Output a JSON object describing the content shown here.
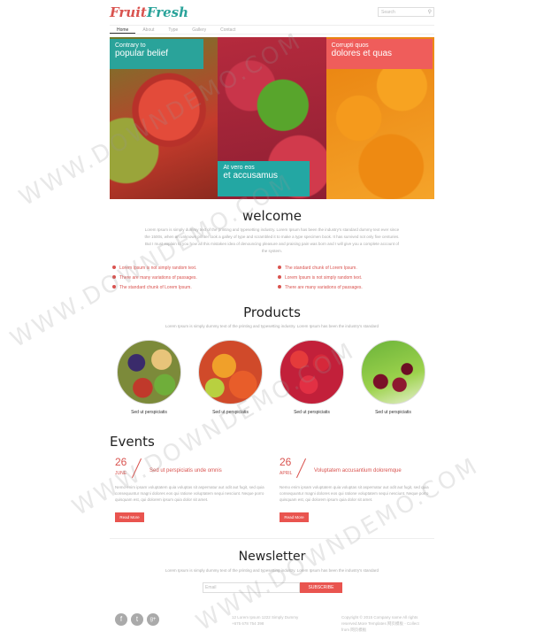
{
  "header": {
    "logo_part1": "Fruit",
    "logo_part2": "Fresh",
    "search_placeholder": "Search"
  },
  "nav": {
    "items": [
      "Home",
      "About",
      "Type",
      "Gallery",
      "Contact"
    ]
  },
  "hero": {
    "panel1": {
      "small": "Contrary to",
      "large": "popular belief"
    },
    "panel2": {
      "small": "At vero eos",
      "large": "et accusamus"
    },
    "panel3": {
      "small": "Corrupti quos",
      "large": "dolores et quas"
    }
  },
  "welcome": {
    "title": "welcome",
    "text": "Lorem Ipsum is simply dummy text of the printing and typesetting industry. Lorem Ipsum has been the industry's standard dummy text ever since the 1500s, when an unknown printer took a galley of type and scrambled it to make a type specimen book. It has survived not only five centuries. But I must explain to you how all this mistaken idea of denouncing pleasure and praising pain was born and I will give you a complete account of the system.",
    "bullets_left": [
      "Lorem Ipsum is not simply random text.",
      "There are many variations of passages.",
      "The standard chunk of Lorem Ipsum."
    ],
    "bullets_right": [
      "The standard chunk of Lorem Ipsum.",
      "Lorem Ipsum is not simply random text.",
      "There are many variations of passages."
    ]
  },
  "products": {
    "title": "Products",
    "text": "Lorem Ipsum is simply dummy text of the printing and typesetting industry. Lorem Ipsum has been the industry's standard",
    "items": [
      "Sed ut perspiciatis",
      "Sed ut perspiciatis",
      "Sed ut perspiciatis",
      "Sed ut perspiciatis"
    ]
  },
  "events": {
    "title": "Events",
    "items": [
      {
        "day": "26",
        "month": "JUNE",
        "title": "Sed ut perspiciatis unde omnis",
        "text": "Nemo enim ipsam voluptatem quia voluptas sit aspernatur aut odit aut fugit, sed quia consequuntur magni dolores eos qui ratione voluptatem sequi nesciunt. Neque porro quisquam est, qui dolorem ipsum quia dolor sit amet.",
        "button": "Read More"
      },
      {
        "day": "26",
        "month": "APRIL",
        "title": "Voluptatem accusantium doloremque",
        "text": "Nemo enim ipsam voluptatem quia voluptas sit aspernatur aut odit aut fugit, sed quia consequuntur magni dolores eos qui ratione voluptatem sequi nesciunt. Neque porro quisquam est, qui dolorem ipsum quia dolor sit amet.",
        "button": "Read More"
      }
    ]
  },
  "newsletter": {
    "title": "Newsletter",
    "text": "Lorem Ipsum is simply dummy text of the printing and typesetting industry. Lorem Ipsum has been the industry's standard",
    "placeholder": "Email",
    "button": "SUBSCRIBE"
  },
  "footer": {
    "social": [
      "f",
      "t",
      "g+"
    ],
    "address_line1": "12 Lorem Ipsum 1222 Simply Dummy",
    "address_line2": "+675 678 754 398",
    "copyright_line1": "Copyright © 2015 Company name All rights",
    "copyright_line2": "reserved.More Templates 网页模板 - Collect from 网页模板"
  },
  "watermark": "WWW.DOWNDEMO.COM",
  "colors": {
    "accent_red": "#e9544f",
    "accent_teal": "#2aa39a"
  }
}
